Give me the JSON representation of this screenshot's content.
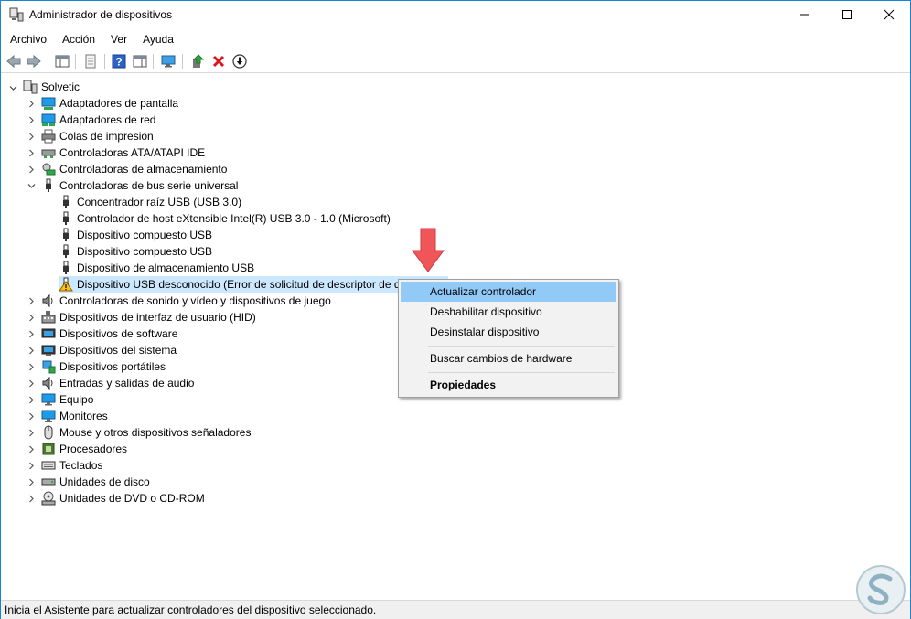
{
  "window": {
    "title": "Administrador de dispositivos"
  },
  "menu": [
    "Archivo",
    "Acción",
    "Ver",
    "Ayuda"
  ],
  "tree": {
    "root": "Solvetic",
    "categories": [
      "Adaptadores de pantalla",
      "Adaptadores de red",
      "Colas de impresión",
      "Controladoras ATA/ATAPI IDE",
      "Controladoras de almacenamiento",
      "Controladoras de bus serie universal",
      "Controladoras de sonido y vídeo y dispositivos de juego",
      "Dispositivos de interfaz de usuario (HID)",
      "Dispositivos de software",
      "Dispositivos del sistema",
      "Dispositivos portátiles",
      "Entradas y salidas de audio",
      "Equipo",
      "Monitores",
      "Mouse y otros dispositivos señaladores",
      "Procesadores",
      "Teclados",
      "Unidades de disco",
      "Unidades de DVD o CD-ROM"
    ],
    "usb_children": [
      "Concentrador raíz USB (USB 3.0)",
      "Controlador de host eXtensible Intel(R) USB 3.0 - 1.0 (Microsoft)",
      "Dispositivo compuesto USB",
      "Dispositivo compuesto USB",
      "Dispositivo de almacenamiento USB",
      "Dispositivo USB desconocido (Error de solicitud de descriptor de di"
    ]
  },
  "context_menu": {
    "update": "Actualizar controlador",
    "disable": "Deshabilitar dispositivo",
    "uninstall": "Desinstalar dispositivo",
    "scan": "Buscar cambios de hardware",
    "properties": "Propiedades"
  },
  "status": "Inicia el Asistente para actualizar controladores del dispositivo seleccionado.",
  "colors": {
    "selection": "#cce8ff",
    "menu_highlight": "#91c9f7",
    "arrow": "#f0555a",
    "border": "#1883d7"
  }
}
